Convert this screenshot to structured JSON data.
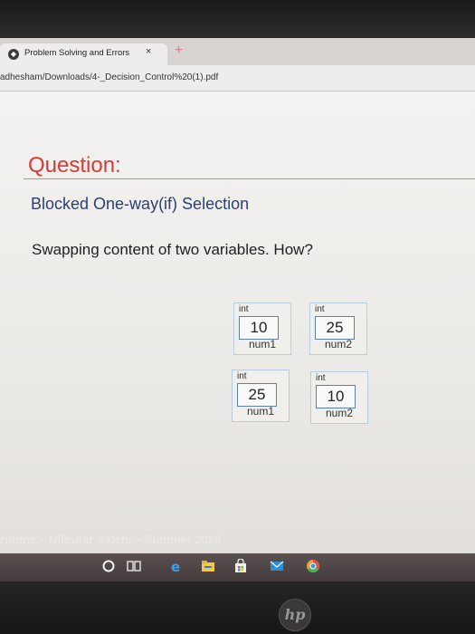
{
  "browser": {
    "tab_title": "Problem Solving and Errors",
    "tab_close": "×",
    "new_tab": "+",
    "address": "adhesham/Downloads/4-_Decision_Control%20(1).pdf"
  },
  "slide": {
    "heading": "Question:",
    "subtitle": "Blocked One-way(if) Selection",
    "body": "Swapping content of two variables. How?",
    "variables_before": [
      {
        "type": "int",
        "value": "10",
        "name": "num1"
      },
      {
        "type": "int",
        "value": "25",
        "name": "num2"
      }
    ],
    "variables_after": [
      {
        "type": "int",
        "value": "25",
        "name": "num1"
      },
      {
        "type": "int",
        "value": "10",
        "name": "num2"
      }
    ],
    "footer": "rithms – Niloufar Salehi – Summer 2020"
  },
  "taskbar": {
    "icons": [
      "cortana-circle-icon",
      "task-view-icon",
      "edge-icon",
      "file-explorer-icon",
      "store-icon",
      "mail-icon",
      "chrome-icon"
    ]
  },
  "device": {
    "logo": "hp"
  }
}
